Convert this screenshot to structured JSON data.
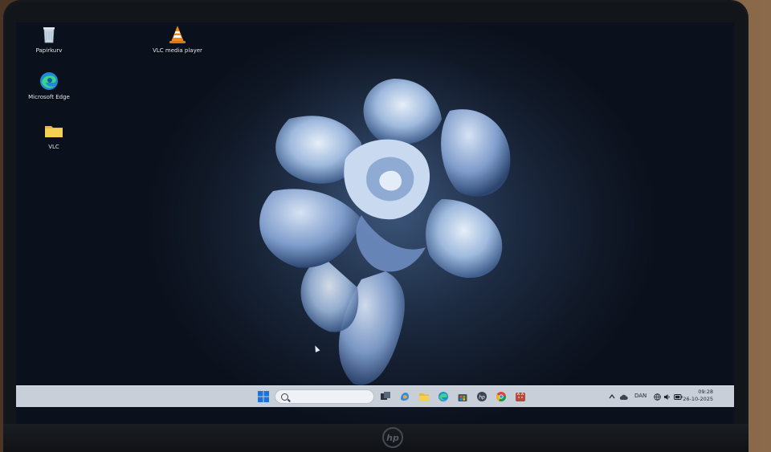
{
  "desktop": {
    "icons": [
      {
        "id": "recycle",
        "label": "Papirkurv",
        "icon": "recycle-bin-icon"
      },
      {
        "id": "vlc-player",
        "label": "VLC media player",
        "icon": "vlc-cone-icon"
      },
      {
        "id": "edge",
        "label": "Microsoft Edge",
        "icon": "edge-icon"
      },
      {
        "id": "vlc-folder",
        "label": "VLC",
        "icon": "folder-icon"
      }
    ]
  },
  "taskbar": {
    "search": {
      "placeholder": ""
    },
    "apps": [
      {
        "name": "start-button",
        "icon": "windows-logo-icon"
      },
      {
        "name": "task-view-button",
        "icon": "task-view-icon"
      },
      {
        "name": "copilot-button",
        "icon": "copilot-icon"
      },
      {
        "name": "file-explorer-button",
        "icon": "folder-icon"
      },
      {
        "name": "edge-button",
        "icon": "edge-icon"
      },
      {
        "name": "store-button",
        "icon": "store-icon"
      },
      {
        "name": "hp-app-button",
        "icon": "hp-icon"
      },
      {
        "name": "chrome-button",
        "icon": "chrome-icon"
      },
      {
        "name": "cat-app-button",
        "icon": "cat-icon"
      }
    ],
    "tray": {
      "language": "DAN",
      "time": "09:28",
      "date": "26-10-2025"
    }
  },
  "hardware": {
    "brand": "hp"
  },
  "colors": {
    "taskbar": "#c8cfd8",
    "wallpaper_dark": "#0b111c",
    "wallpaper_glow": "#2f4666",
    "flower": "#9db8dc"
  }
}
